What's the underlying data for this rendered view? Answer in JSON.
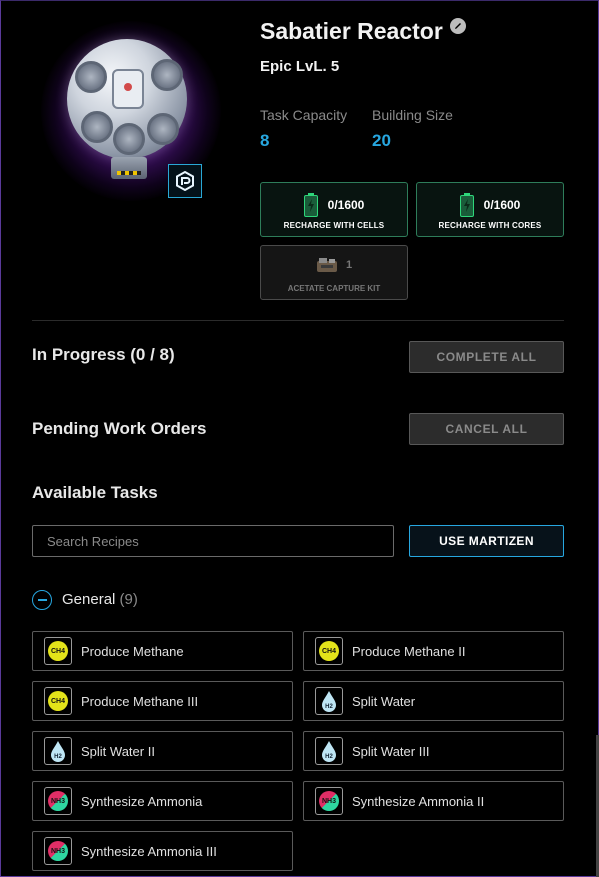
{
  "building": {
    "name": "Sabatier Reactor",
    "rarity_level": "Epic LvL. 5",
    "stats": [
      {
        "label": "Task Capacity",
        "value": "8"
      },
      {
        "label": "Building Size",
        "value": "20"
      }
    ],
    "accent_color": "#27a7e0",
    "glow_color": "#8a3be0"
  },
  "recharge": [
    {
      "count": "0/1600",
      "label": "RECHARGE WITH CELLS",
      "icon": "battery-icon"
    },
    {
      "count": "0/1600",
      "label": "RECHARGE WITH CORES",
      "icon": "battery-icon"
    }
  ],
  "kit": {
    "count": "1",
    "label": "ACETATE CAPTURE KIT",
    "icon": "capture-kit-icon"
  },
  "in_progress": {
    "title": "In Progress (0 / 8)",
    "button": "COMPLETE ALL"
  },
  "pending": {
    "title": "Pending Work Orders",
    "button": "CANCEL ALL"
  },
  "available": {
    "title": "Available Tasks",
    "search_placeholder": "Search Recipes",
    "martizen_button": "USE MARTIZEN"
  },
  "group": {
    "name": "General",
    "count": "(9)"
  },
  "tasks": [
    {
      "name": "Produce Methane",
      "icon": "methane-icon"
    },
    {
      "name": "Produce Methane II",
      "icon": "methane-icon"
    },
    {
      "name": "Produce Methane III",
      "icon": "methane-icon"
    },
    {
      "name": "Split Water",
      "icon": "water-drop-icon"
    },
    {
      "name": "Split Water II",
      "icon": "water-drop-icon"
    },
    {
      "name": "Split Water III",
      "icon": "water-drop-icon"
    },
    {
      "name": "Synthesize Ammonia",
      "icon": "ammonia-icon"
    },
    {
      "name": "Synthesize Ammonia II",
      "icon": "ammonia-icon"
    },
    {
      "name": "Synthesize Ammonia III",
      "icon": "ammonia-icon"
    }
  ],
  "icon_text": {
    "methane": "CH4",
    "water": "H2",
    "ammonia": "NH3"
  }
}
